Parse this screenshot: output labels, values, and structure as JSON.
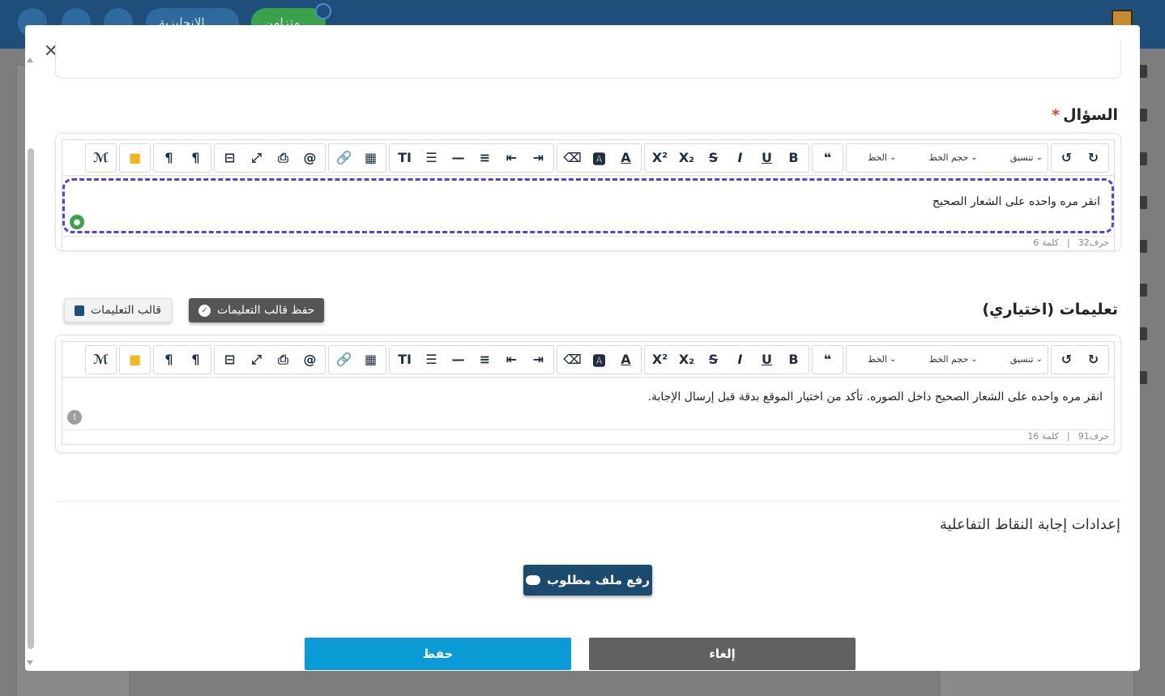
{
  "header": {
    "language_label": "الإنجليزية",
    "sync_label": "متزامن"
  },
  "question": {
    "title": "السؤال",
    "required_mark": "*",
    "content": "انقر مره واحده على الشعار الصحيح",
    "char_count": "حرف32",
    "word_count": "كلمة 6"
  },
  "instructions": {
    "title": "تعليمات (اختياري)",
    "save_template_label": "حفظ قالب التعليمات",
    "template_label": "قالب التعليمات",
    "content": "انقر مره واحده على الشعار الصحيح داخل الصوره. تأكد من اختيار الموقع بدقة قبل إرسال الإجابة.",
    "char_count": "حرف91",
    "word_count": "كلمة 16"
  },
  "toolbar": {
    "format_label": "تنسيق",
    "font_size_label": "حجم الخط",
    "font_label": "الخط"
  },
  "settings": {
    "title": "إعدادات إجابة النقاط التفاعلية",
    "upload_label": "رفع ملف مطلوب"
  },
  "footer": {
    "save_label": "حفظ",
    "cancel_label": "إلغاء"
  },
  "colors": {
    "primary": "#1a4a6d",
    "save": "#0a9ad6",
    "cancel": "#616161",
    "focus_border": "#5b3fd6",
    "required": "#e53935"
  }
}
